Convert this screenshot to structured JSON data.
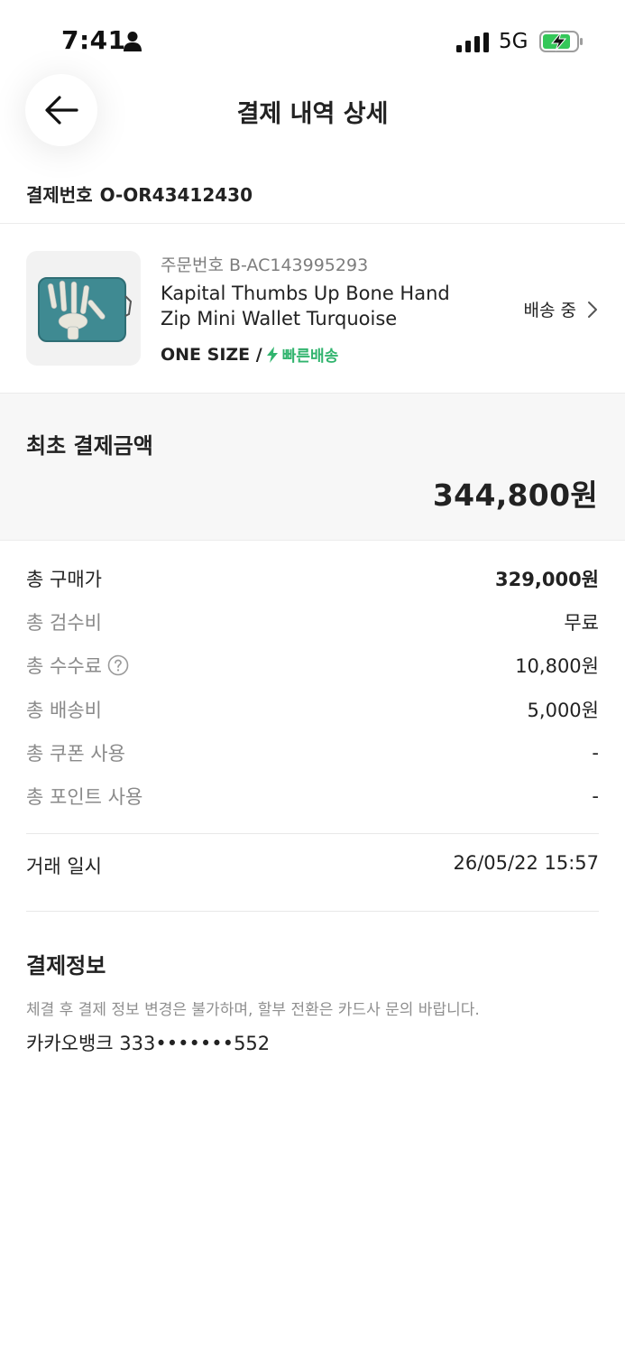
{
  "status_bar": {
    "time": "7:41",
    "network": "5G",
    "colors": {
      "battery_charging": "#34c759"
    }
  },
  "header": {
    "title": "결제 내역 상세",
    "back_icon": "arrow-left-icon"
  },
  "payment": {
    "number_label": "결제번호",
    "number_value": "O-OR43412430"
  },
  "product": {
    "order_number": "주문번호 B-AC143995293",
    "name": "Kapital Thumbs Up Bone Hand Zip Mini Wallet Turquoise",
    "option": "ONE SIZE /",
    "fast_delivery": "빠른배송",
    "status": "배송 중",
    "colors": {
      "fast_delivery": "#31b46e",
      "wallet": "#3f8a92"
    }
  },
  "total": {
    "label": "최초 결제금액",
    "value": "344,800원"
  },
  "breakdown": [
    {
      "label": "총 구매가",
      "value": "329,000원"
    },
    {
      "label": "총 검수비",
      "value": "무료"
    },
    {
      "label": "총 수수료",
      "value": "10,800원",
      "icon": "help-circle-icon"
    },
    {
      "label": "총 배송비",
      "value": "5,000원"
    },
    {
      "label": "총 쿠폰 사용",
      "value": "-"
    },
    {
      "label": "총 포인트 사용",
      "value": "-"
    }
  ],
  "transaction": {
    "label": "거래 일시",
    "value": "26/05/22 15:57"
  },
  "payment_info": {
    "title": "결제정보",
    "note": "체결 후 결제 정보 변경은 불가하며, 할부 전환은 카드사 문의 바랍니다.",
    "method": "카카오뱅크 333•••••••552"
  }
}
